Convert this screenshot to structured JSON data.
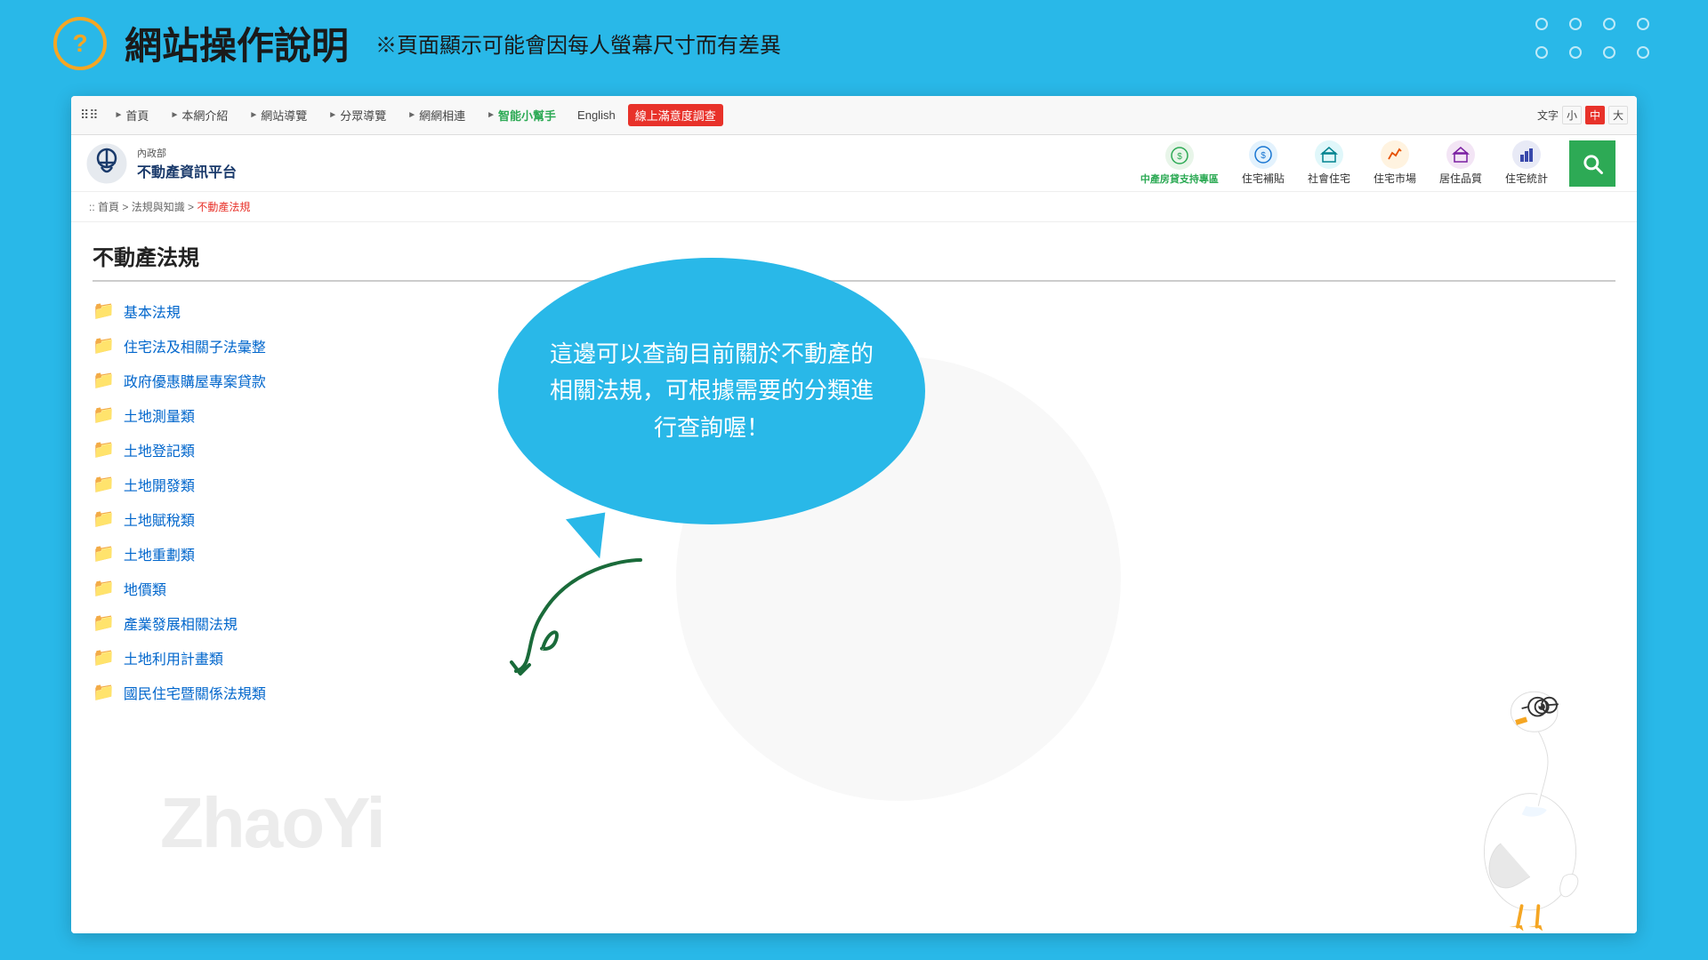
{
  "header": {
    "icon_label": "?",
    "title": "網站操作說明",
    "subtitle": "※頁面顯示可能會因每人螢幕尺寸而有差異"
  },
  "nav": {
    "grid_icon": "⠿",
    "items": [
      {
        "label": "首頁",
        "arrow": "►",
        "id": "home"
      },
      {
        "label": "本網介紹",
        "arrow": "►",
        "id": "about"
      },
      {
        "label": "網站導覽",
        "arrow": "►",
        "id": "sitemap"
      },
      {
        "label": "分眾導覽",
        "arrow": "►",
        "id": "audience"
      },
      {
        "label": "網網相連",
        "arrow": "►",
        "id": "links"
      },
      {
        "label": "智能小幫手",
        "arrow": "►",
        "id": "ai",
        "special": "green"
      },
      {
        "label": "English",
        "id": "english"
      },
      {
        "label": "線上滿意度調查",
        "id": "survey",
        "special": "red"
      }
    ],
    "font_size": {
      "label": "文字",
      "sizes": [
        "小",
        "中",
        "大"
      ],
      "active": "中"
    }
  },
  "logo": {
    "org_name": "內政部",
    "platform_name": "不動產資訊平台"
  },
  "logo_nav": [
    {
      "label": "中產房貸支持專區",
      "icon": "🏦",
      "color": "green"
    },
    {
      "label": "住宅補貼",
      "icon": "💰",
      "color": "blue"
    },
    {
      "label": "社會住宅",
      "icon": "🏢",
      "color": "teal"
    },
    {
      "label": "住宅市場",
      "icon": "📊",
      "color": "orange"
    },
    {
      "label": "居住品質",
      "icon": "🏠",
      "color": "purple"
    },
    {
      "label": "住宅統計",
      "icon": "📈",
      "color": "darkblue"
    }
  ],
  "breadcrumb": {
    "items": [
      ":: 首頁",
      "法規與知識",
      "不動產法規"
    ],
    "separator": " > "
  },
  "page": {
    "title": "不動產法規",
    "law_items": [
      {
        "label": "基本法規"
      },
      {
        "label": "住宅法及相關子法彙整"
      },
      {
        "label": "政府優惠購屋專案貸款"
      },
      {
        "label": "土地測量類"
      },
      {
        "label": "土地登記類"
      },
      {
        "label": "土地開發類"
      },
      {
        "label": "土地賦稅類"
      },
      {
        "label": "土地重劃類"
      },
      {
        "label": "地價類"
      },
      {
        "label": "產業發展相關法規"
      },
      {
        "label": "土地利用計畫類"
      },
      {
        "label": "國民住宅暨關係法規類"
      }
    ]
  },
  "speech_bubble": {
    "text": "這邊可以查詢目前關於不動產的相關法規，可根據需要的分類進行查詢喔！"
  },
  "watermark_text": "ZhaoYi"
}
